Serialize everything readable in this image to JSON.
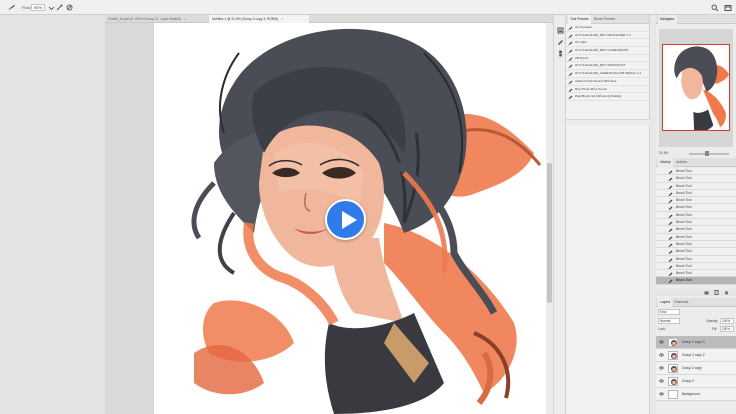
{
  "options_bar": {
    "flow_label": "Flow:",
    "flow_value": "90%"
  },
  "doc_tabs": [
    {
      "label": "Sketch_M.psd @ 100% (Group 12, Layer Mask/8)",
      "close": "×"
    },
    {
      "label": "Untitled-1 @ 31.5% (Group 2 copy 3, RGB/8)",
      "close": "×"
    }
  ],
  "presets": {
    "tabs": [
      "Tool Presets",
      "Brush Presets"
    ],
    "items": [
      "01 oil pastel",
      "01 KYLECALMO_DRY PENCILINER 1.2",
      "01 Inkjet",
      "01 KYLECALMO_DRY CLIME BRUSH",
      "2B Pencil",
      "01 KYLECALMO_DRY WASH/SOFT",
      "01 KYLECALMO_GREENLITE FAB PENCIL 1.2",
      "Airbrush Soft Round 30% flow",
      "Rice Photo Brus Pencil",
      "PaintBrush Grid 68 plenty Multiply"
    ]
  },
  "navigator": {
    "tab": "Navigator",
    "zoom": "31.5%"
  },
  "history": {
    "tabs": [
      "History",
      "Actions"
    ],
    "items": [
      "Brush Tool",
      "Brush Tool",
      "Brush Tool",
      "Brush Tool",
      "Brush Tool",
      "Brush Tool",
      "Brush Tool",
      "Brush Tool",
      "Brush Tool",
      "Brush Tool",
      "Brush Tool",
      "Brush Tool",
      "Brush Tool",
      "Brush Tool",
      "Brush Tool",
      "Brush Tool"
    ]
  },
  "layers": {
    "tabs": [
      "Layers",
      "Channels"
    ],
    "kind": "Kind",
    "blend": "Normal",
    "opacity_label": "Opacity:",
    "opacity": "100%",
    "lock_label": "Lock:",
    "fill_label": "Fill:",
    "fill": "100%",
    "items": [
      {
        "name": "Group 2 copy 3"
      },
      {
        "name": "Group 2 copy 2"
      },
      {
        "name": "Group 2 copy"
      },
      {
        "name": "Group 2"
      },
      {
        "name": "Background"
      }
    ]
  },
  "colors": {
    "play_button": "#2f7ce8",
    "hair": "#4a4c56",
    "ribbon": "#f07a4c",
    "skin": "#f1b79c",
    "dress": "#383a40",
    "selection": "#d73a2c"
  }
}
